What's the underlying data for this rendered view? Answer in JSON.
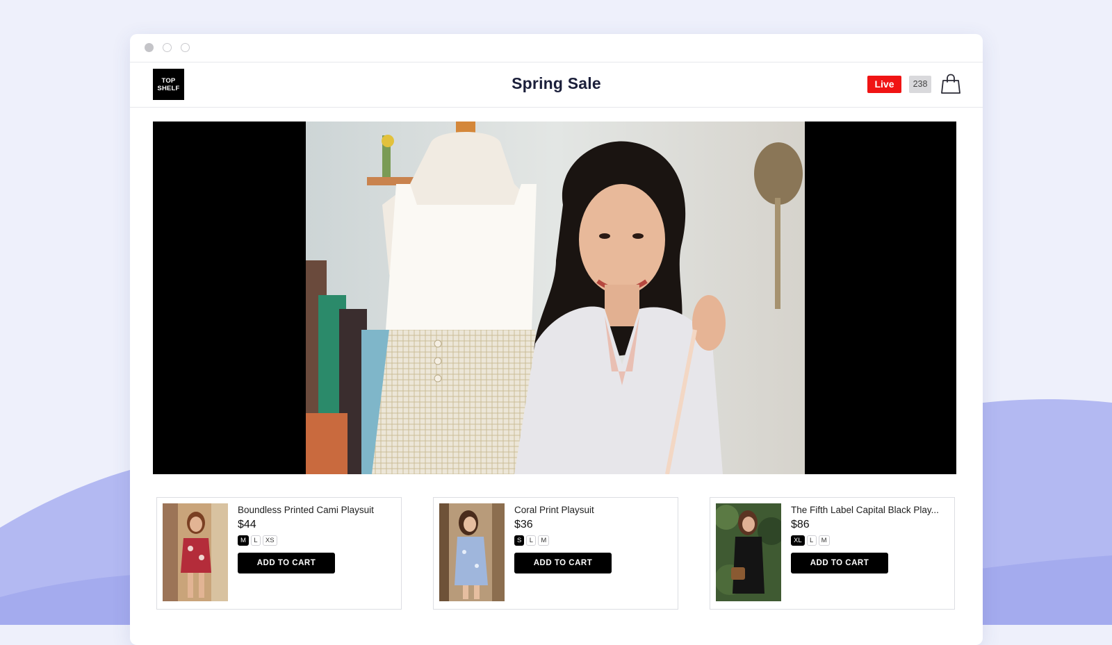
{
  "header": {
    "logo_line1": "TOP",
    "logo_line2": "SHELF",
    "title": "Spring Sale",
    "live_label": "Live",
    "viewer_count": "238"
  },
  "icons": {
    "cart": "shopping-bag-icon"
  },
  "colors": {
    "live_red": "#f01414",
    "button_black": "#000000",
    "title_navy": "#1b1f3a"
  },
  "products": [
    {
      "name": "Boundless Printed Cami Playsuit",
      "price": "$44",
      "sizes": [
        "M",
        "L",
        "XS"
      ],
      "selected_size": "M",
      "button": "ADD TO CART"
    },
    {
      "name": "Coral Print Playsuit",
      "price": "$36",
      "sizes": [
        "S",
        "L",
        "M"
      ],
      "selected_size": "S",
      "button": "ADD TO CART"
    },
    {
      "name": "The Fifth Label Capital Black Play...",
      "price": "$86",
      "sizes": [
        "XL",
        "L",
        "M"
      ],
      "selected_size": "XL",
      "button": "ADD TO CART"
    }
  ]
}
